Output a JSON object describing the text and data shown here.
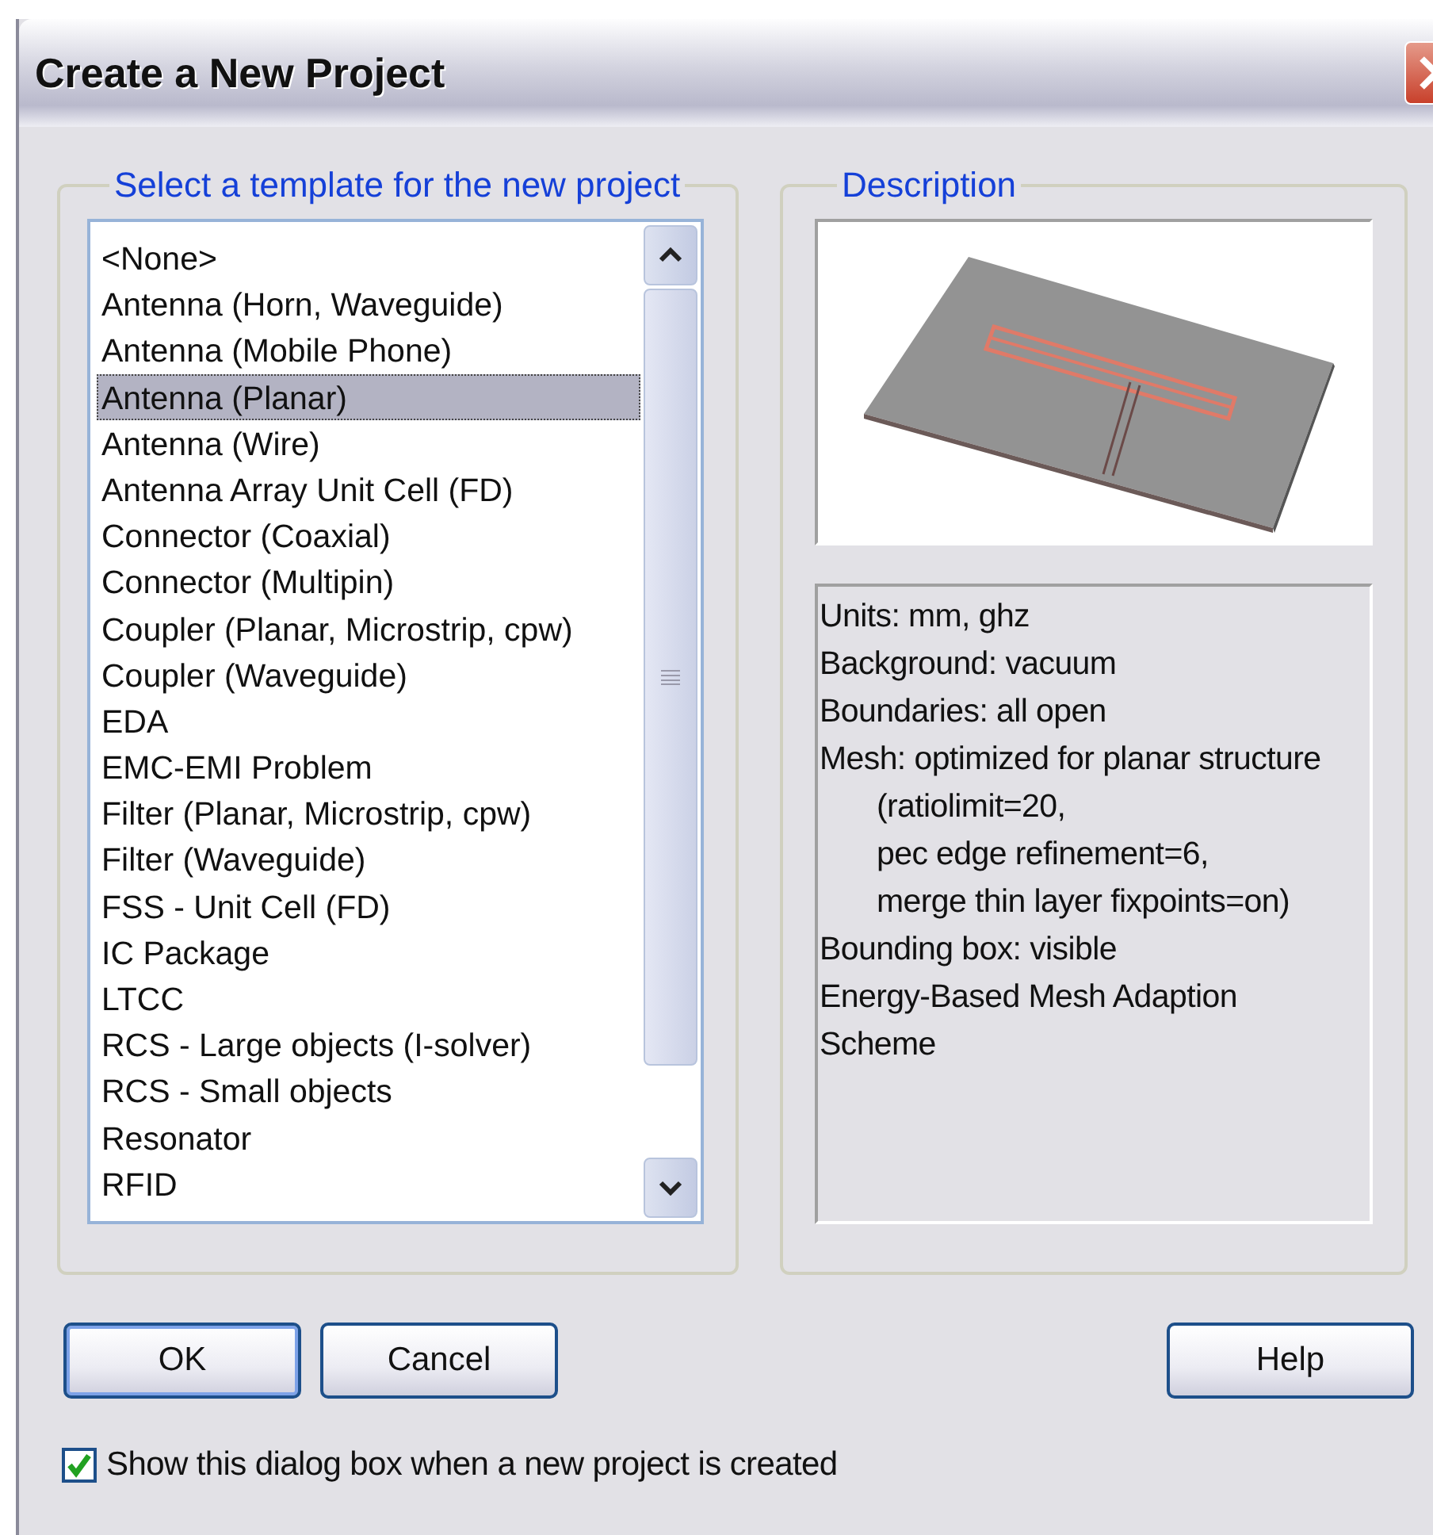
{
  "window": {
    "title": "Create a New Project"
  },
  "templates": {
    "label": "Select a template for the new project",
    "items": [
      {
        "label": "<None>",
        "selected": false
      },
      {
        "label": "Antenna (Horn, Waveguide)",
        "selected": false
      },
      {
        "label": "Antenna (Mobile Phone)",
        "selected": false
      },
      {
        "label": "Antenna (Planar)",
        "selected": true
      },
      {
        "label": "Antenna (Wire)",
        "selected": false
      },
      {
        "label": "Antenna Array Unit Cell (FD)",
        "selected": false
      },
      {
        "label": "Connector (Coaxial)",
        "selected": false
      },
      {
        "label": "Connector (Multipin)",
        "selected": false
      },
      {
        "label": "Coupler (Planar, Microstrip, cpw)",
        "selected": false
      },
      {
        "label": "Coupler (Waveguide)",
        "selected": false
      },
      {
        "label": "EDA",
        "selected": false
      },
      {
        "label": "EMC-EMI Problem",
        "selected": false
      },
      {
        "label": "Filter (Planar, Microstrip, cpw)",
        "selected": false
      },
      {
        "label": "Filter (Waveguide)",
        "selected": false
      },
      {
        "label": "FSS - Unit Cell (FD)",
        "selected": false
      },
      {
        "label": "IC Package",
        "selected": false
      },
      {
        "label": "LTCC",
        "selected": false
      },
      {
        "label": "RCS - Large objects (I-solver)",
        "selected": false
      },
      {
        "label": "RCS - Small objects",
        "selected": false
      },
      {
        "label": "Resonator",
        "selected": false
      },
      {
        "label": "RFID",
        "selected": false
      }
    ]
  },
  "description": {
    "label": "Description",
    "lines": [
      {
        "text": "Units: mm, ghz",
        "indented": false
      },
      {
        "text": "Background: vacuum",
        "indented": false
      },
      {
        "text": "Boundaries: all open",
        "indented": false
      },
      {
        "text": "Mesh: optimized for planar structure",
        "indented": false
      },
      {
        "text": "(ratiolimit=20,",
        "indented": true
      },
      {
        "text": "pec edge refinement=6,",
        "indented": true
      },
      {
        "text": "merge thin layer fixpoints=on)",
        "indented": true
      },
      {
        "text": "Bounding box: visible",
        "indented": false
      },
      {
        "text": "Energy-Based Mesh Adaption",
        "indented": false
      },
      {
        "text": "Scheme",
        "indented": false
      }
    ]
  },
  "buttons": [
    {
      "label": "OK",
      "kind": "default"
    },
    {
      "label": "Cancel",
      "kind": "normal"
    },
    {
      "label": "Help",
      "kind": "normal"
    }
  ],
  "show_dialog_checkbox": {
    "label": "Show this dialog box when a new project is created",
    "checked": true
  }
}
